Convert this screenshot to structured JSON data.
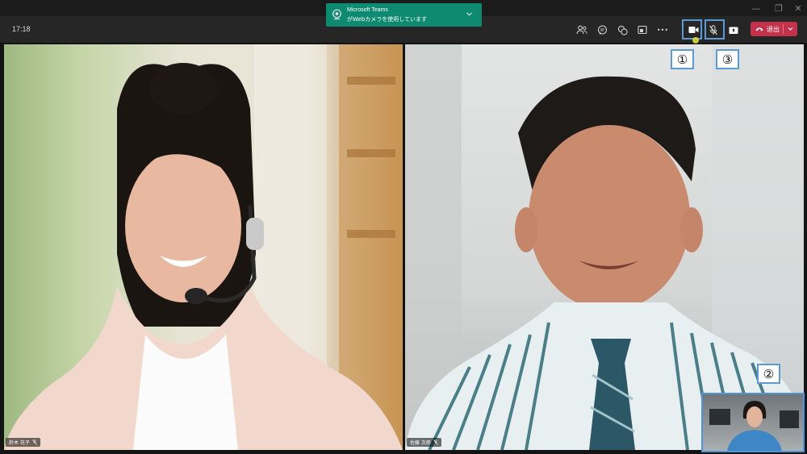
{
  "titlebar": {
    "min": "—",
    "restore": "❐",
    "close": "✕"
  },
  "toolbar": {
    "clock": "17:18",
    "buttons": [
      "participants-icon",
      "chat-icon",
      "reactions-icon",
      "rooms-icon",
      "more-icon",
      "camera-icon",
      "microphone-icon",
      "share-icon"
    ],
    "more_glyph": "•••",
    "leave_label": "退出"
  },
  "toast": {
    "title": "Microsoft Teams",
    "message": "がWebカメラを使用しています"
  },
  "participants": [
    {
      "name": "鈴木 花子"
    },
    {
      "name": "佐藤 次郎"
    }
  ],
  "annotations": {
    "one": "①",
    "two": "②",
    "three": "③"
  },
  "colors": {
    "toast_bg": "#0e8a70",
    "leave_bg": "#c4314b",
    "callout": "#5b9bd5"
  }
}
